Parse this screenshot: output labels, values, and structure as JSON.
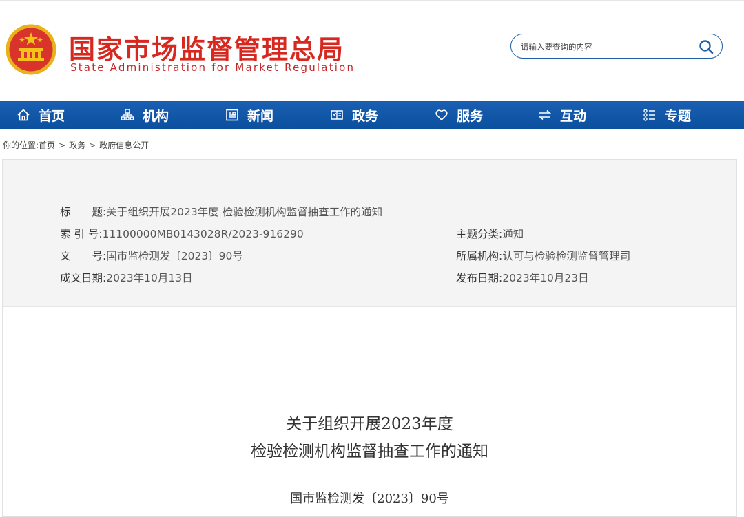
{
  "header": {
    "title_cn": "国家市场监督管理总局",
    "title_en": "State Administration for Market Regulation",
    "emblem_icon": "national-emblem-icon"
  },
  "search": {
    "placeholder": "请输入要查询的内容",
    "icon": "search-icon"
  },
  "nav": {
    "items": [
      {
        "label": "首页",
        "icon": "home-icon"
      },
      {
        "label": "机构",
        "icon": "org-chart-icon"
      },
      {
        "label": "新闻",
        "icon": "news-icon"
      },
      {
        "label": "政务",
        "icon": "government-icon"
      },
      {
        "label": "服务",
        "icon": "heart-icon"
      },
      {
        "label": "互动",
        "icon": "exchange-icon"
      },
      {
        "label": "专题",
        "icon": "topics-icon"
      }
    ]
  },
  "breadcrumb": {
    "prefix": "你的位置:",
    "items": [
      "首页",
      "政务",
      "政府信息公开"
    ],
    "separator": ">"
  },
  "meta": {
    "title_label": "标　　题:",
    "title_value": "关于组织开展2023年度 检验检测机构监督抽查工作的通知",
    "index_label": "索 引 号:",
    "index_value": "11100000MB0143028R/2023-916290",
    "topic_label": "主题分类:",
    "topic_value": "通知",
    "docno_label": "文　　号:",
    "docno_value": "国市监检测发〔2023〕90号",
    "org_label": "所属机构:",
    "org_value": "认可与检验检测监督管理司",
    "written_label": "成文日期:",
    "written_value": "2023年10月13日",
    "published_label": "发布日期:",
    "published_value": "2023年10月23日"
  },
  "document": {
    "title_line1": "关于组织开展2023年度",
    "title_line2": "检验检测机构监督抽查工作的通知",
    "number": "国市监检测发〔2023〕90号"
  },
  "colors": {
    "brand_red": "#d6281f",
    "nav_blue": "#0b4f9e",
    "meta_bg": "#f4f4f4"
  }
}
